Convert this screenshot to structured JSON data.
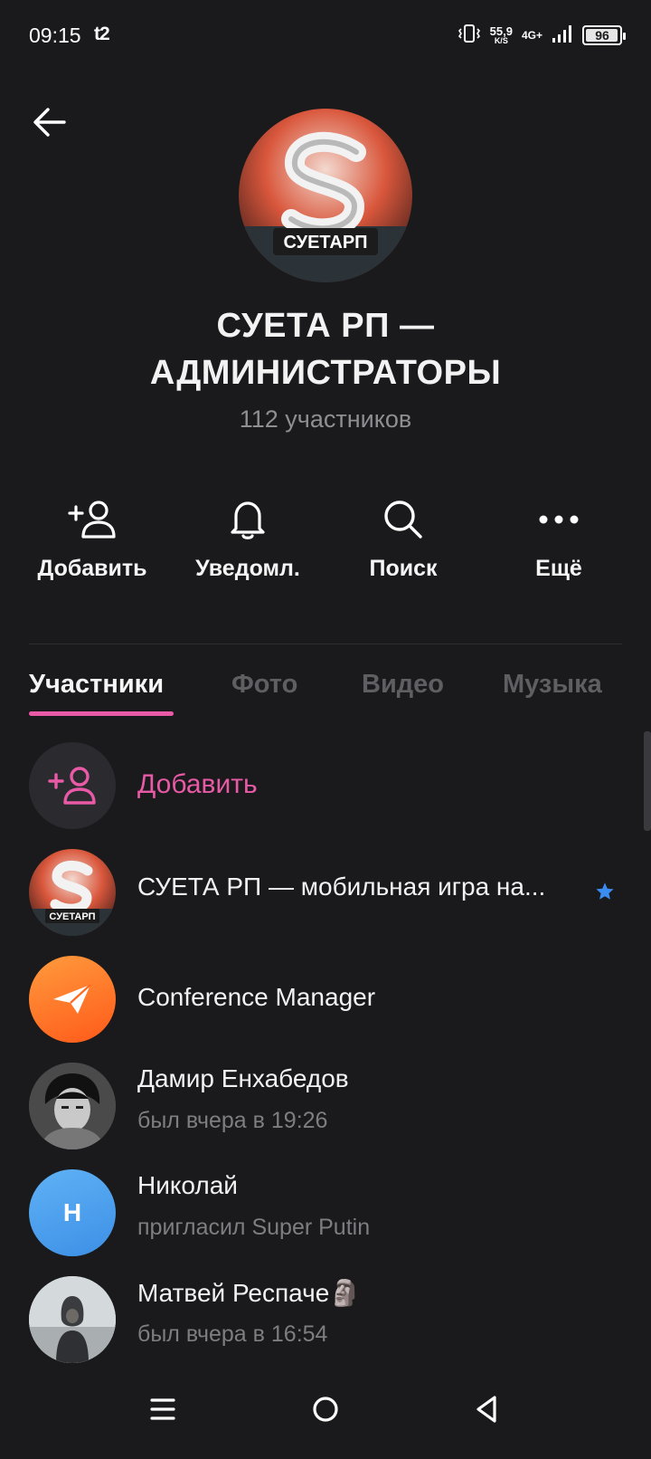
{
  "status_bar": {
    "time": "09:15",
    "carrier": "t2",
    "speed_value": "55,9",
    "speed_unit": "K/S",
    "network": "4G+",
    "battery": "96",
    "battery_level": 0.96
  },
  "header": {
    "back_icon": "arrow-left-icon",
    "avatar_text": "СУЕТАРП",
    "title": "СУЕТА РП — АДМИНИСТРАТОРЫ",
    "subtitle": "112 участников"
  },
  "actions": [
    {
      "label": "Добавить",
      "icon": "add-user-icon"
    },
    {
      "label": "Уведомл.",
      "icon": "bell-icon"
    },
    {
      "label": "Поиск",
      "icon": "search-icon"
    },
    {
      "label": "Ещё",
      "icon": "more-icon"
    }
  ],
  "tabs": [
    {
      "label": "Участники",
      "active": true
    },
    {
      "label": "Фото",
      "active": false
    },
    {
      "label": "Видео",
      "active": false
    },
    {
      "label": "Музыка",
      "active": false
    }
  ],
  "members": {
    "add_label": "Добавить",
    "items": [
      {
        "name": "СУЕТА РП — мобильная игра на...",
        "status": "",
        "avatar": "group-logo",
        "badge": "star-icon"
      },
      {
        "name": "Conference Manager",
        "status": "",
        "avatar": "paper-plane-icon"
      },
      {
        "name": "Дамир Енхабедов",
        "status": "был вчера в 19:26",
        "avatar": "photo"
      },
      {
        "name": "Николай",
        "status": "пригласил Super Putin",
        "avatar": "initial",
        "initial": "Н"
      },
      {
        "name": "Матвей Респаче🗿",
        "status": "был вчера в 16:54",
        "avatar": "photo"
      }
    ]
  },
  "colors": {
    "background": "#1a1a1c",
    "accent": "#e85aa6",
    "muted": "#8e8e93",
    "star": "#3b8cf0"
  },
  "navbar": {
    "buttons": [
      "menu-icon",
      "home-icon",
      "back-triangle-icon"
    ]
  }
}
